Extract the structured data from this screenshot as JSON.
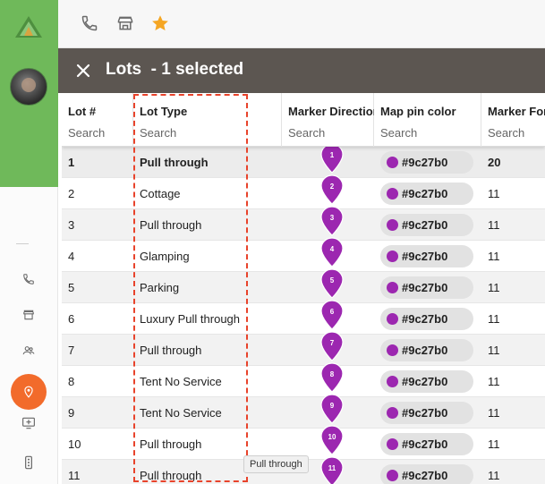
{
  "colors": {
    "brand_green": "#6fb95a",
    "header_bg": "#5c5651",
    "active_orange": "#f26b2b",
    "pin_purple": "#9c27b0",
    "star_orange": "#f5a623",
    "highlight_dashed": "#e8432b"
  },
  "toolbar": {
    "icons": [
      "phone-icon",
      "store-icon",
      "star-icon"
    ]
  },
  "rail": {
    "icons": [
      "phone-icon",
      "store-icon",
      "people-icon",
      "location-pin-icon",
      "add-to-queue-icon",
      "traffic-icon"
    ],
    "active": "location-pin-icon"
  },
  "header": {
    "title": "Lots  - 1 selected"
  },
  "columns": [
    {
      "label": "Lot #",
      "search_placeholder": "Search"
    },
    {
      "label": "Lot Type",
      "search_placeholder": "Search"
    },
    {
      "label": "Marker Direction",
      "search_placeholder": "Search"
    },
    {
      "label": "Map pin color",
      "search_placeholder": "Search"
    },
    {
      "label": "Marker Font",
      "search_placeholder": "Search"
    }
  ],
  "rows": [
    {
      "lot": "1",
      "type": "Pull through",
      "pin": "1",
      "color": "#9c27b0",
      "font": "20",
      "selected": true
    },
    {
      "lot": "2",
      "type": "Cottage",
      "pin": "2",
      "color": "#9c27b0",
      "font": "11"
    },
    {
      "lot": "3",
      "type": "Pull through",
      "pin": "3",
      "color": "#9c27b0",
      "font": "11"
    },
    {
      "lot": "4",
      "type": "Glamping",
      "pin": "4",
      "color": "#9c27b0",
      "font": "11"
    },
    {
      "lot": "5",
      "type": "Parking",
      "pin": "5",
      "color": "#9c27b0",
      "font": "11"
    },
    {
      "lot": "6",
      "type": "Luxury Pull through",
      "pin": "6",
      "color": "#9c27b0",
      "font": "11"
    },
    {
      "lot": "7",
      "type": "Pull through",
      "pin": "7",
      "color": "#9c27b0",
      "font": "11"
    },
    {
      "lot": "8",
      "type": "Tent No Service",
      "pin": "8",
      "color": "#9c27b0",
      "font": "11"
    },
    {
      "lot": "9",
      "type": "Tent No Service",
      "pin": "9",
      "color": "#9c27b0",
      "font": "11"
    },
    {
      "lot": "10",
      "type": "Pull through",
      "pin": "10",
      "color": "#9c27b0",
      "font": "11"
    },
    {
      "lot": "11",
      "type": "Pull through",
      "pin": "11",
      "color": "#9c27b0",
      "font": "11"
    }
  ],
  "tooltip": "Pull through"
}
